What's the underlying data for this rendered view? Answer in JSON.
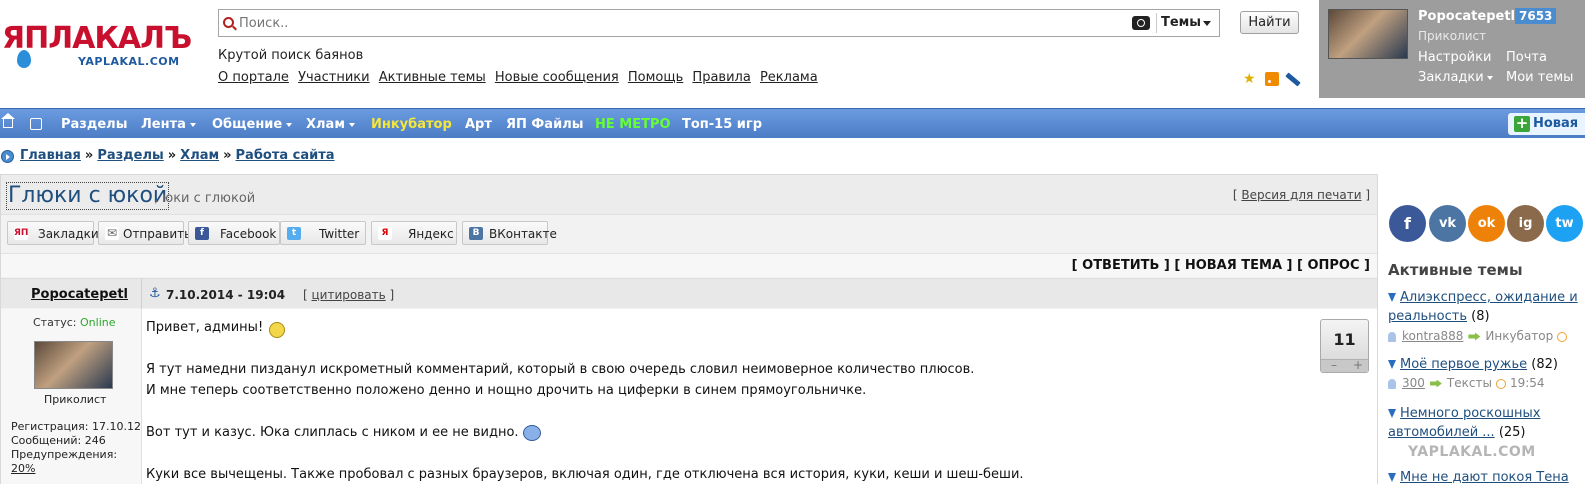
{
  "logo": {
    "main": "ЯПЛАКАЛЪ",
    "sub": "YAPLAKAL.COM"
  },
  "search": {
    "placeholder": "Поиск..",
    "value": "",
    "scope": "Темы",
    "button": "Найти"
  },
  "tagline": "Крутой поиск баянов",
  "toplinks": [
    "О портале",
    "Участники",
    "Активные темы",
    "Новые сообщения",
    "Помощь",
    "Правила",
    "Реклама"
  ],
  "user": {
    "name": "Popocatepetl",
    "count": "7653",
    "rank": "Приколист",
    "links": {
      "settings": "Настройки",
      "mail": "Почта",
      "bookmarks": "Закладки",
      "my_topics": "Мои темы"
    }
  },
  "nav": {
    "items": [
      "Разделы",
      "Лента",
      "Общение",
      "Хлам",
      "Инкубатор",
      "Арт",
      "ЯП Файлы",
      "НЕ МЕТРО",
      "Топ-15 игр"
    ],
    "new_button": "Новая"
  },
  "colors": {
    "incubator": "#f5e63a",
    "ne_metro": "#66ff33",
    "nav_bg": "#5a8ad2",
    "link": "#1f4f7f"
  },
  "breadcrumb": [
    "Главная",
    "Разделы",
    "Хлам",
    "Работа сайта"
  ],
  "breadcrumb_sep": "»",
  "topic": {
    "title": "Глюки с юкой",
    "description": ", юки с глюкой",
    "print": "Версия для печати"
  },
  "share": [
    "Закладки",
    "Отправить",
    "Facebook",
    "Twitter",
    "Яндекс",
    "ВКонтакте"
  ],
  "share_icons": [
    "ЯП",
    "✉",
    "f",
    "t",
    "Я",
    "В"
  ],
  "actions": "[ ОТВЕТИТЬ ] [ НОВАЯ ТЕМА ] [ ОПРОС ]",
  "post": {
    "author": "Popocatepetl",
    "date": "7.10.2014 - 19:04",
    "quote": "цитировать",
    "status_label": "Статус:",
    "status": "Online",
    "rank": "Приколист",
    "registration": "Регистрация: 17.10.12",
    "messages": "Сообщений: 246",
    "warnings_label": "Предупреждения:",
    "warnings": "20%",
    "lines": [
      "Привет, админы!",
      "Я тут намедни пизданул искрометный комментарий, который в свою очередь словил неимоверное количество плюсов.",
      "И мне теперь соответственно положено денно и нощно дрочить на циферки в синем прямоугольничке.",
      "Вот тут и казус. Юка слиплась с ником и ее не видно.",
      "Куки все вычещены. Также пробовал с разных браузеров, включая один, где отключена вся история, куки, кеши и шеш-беши."
    ],
    "rating": "11",
    "rating_minus": "–",
    "rating_plus": "+"
  },
  "sidebar": {
    "social": [
      "f",
      "vk",
      "ok",
      "ig",
      "tw"
    ],
    "active_title": "Активные темы",
    "topics": [
      {
        "title": "Алиэкспресс, ожидание и реальность",
        "count": "(8)",
        "user": "kontra888",
        "section": "Инкубатор",
        "time": ""
      },
      {
        "title": "Моё первое ружье",
        "count": "(82)",
        "user": "300",
        "section": "Тексты",
        "time": "19:54"
      },
      {
        "title": "Немного роскошных автомобилей ...",
        "count": "(25)",
        "user": "",
        "section": "",
        "time": ""
      },
      {
        "title": "Мне не дают покоя Тена",
        "count": "",
        "user": "",
        "section": "",
        "time": ""
      }
    ],
    "watermark": "YAPLAKAL.COM"
  }
}
